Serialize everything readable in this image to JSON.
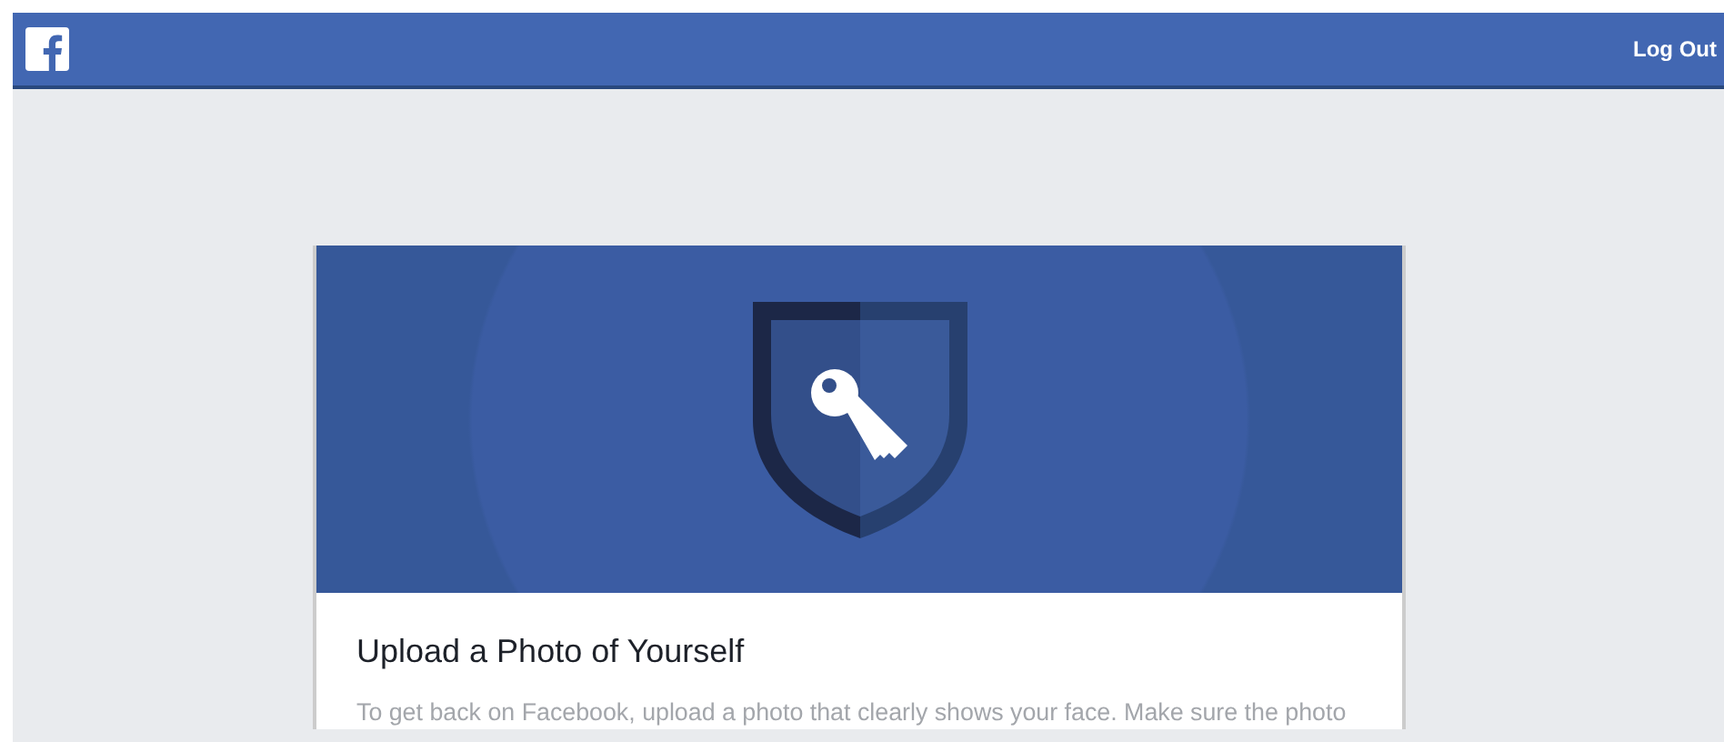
{
  "top_bar": {
    "logout_link": "Log Out"
  },
  "card": {
    "title": "Upload a Photo of Yourself",
    "description": "To get back on Facebook, upload a photo that clearly shows your face. Make sure the photo"
  }
}
